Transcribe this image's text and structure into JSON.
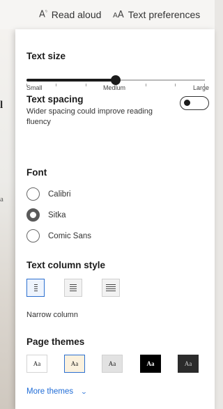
{
  "toolbar": {
    "read_aloud": {
      "label": "Read aloud",
      "icon": "read-aloud-icon"
    },
    "text_preferences": {
      "label": "Text preferences",
      "icon": "text-preferences-icon"
    }
  },
  "background": {
    "glyph1": "l",
    "glyph2": "a"
  },
  "panel": {
    "text_size": {
      "title": "Text size",
      "level": 0.5,
      "labels": {
        "small": "Small",
        "medium": "Medium",
        "large": "Large"
      },
      "selected": "Medium"
    },
    "text_spacing": {
      "title": "Text spacing",
      "description": "Wider spacing could improve reading fluency",
      "enabled": false
    },
    "font": {
      "title": "Font",
      "options": [
        {
          "label": "Calibri",
          "checked": false
        },
        {
          "label": "Sitka",
          "checked": true
        },
        {
          "label": "Comic Sans",
          "checked": false
        }
      ]
    },
    "column_style": {
      "title": "Text column style",
      "options": [
        "narrow",
        "medium",
        "wide"
      ],
      "selected": "narrow",
      "caption": "Narrow column"
    },
    "page_themes": {
      "title": "Page themes",
      "sample": "Aa",
      "themes": [
        {
          "name": "light",
          "bg": "#ffffff",
          "fg": "#1b1b1b",
          "border": "#d4d4d4"
        },
        {
          "name": "sepia",
          "bg": "#fbf1de",
          "fg": "#1b1b1b",
          "border": "#2b6fd0",
          "selected": true
        },
        {
          "name": "gray",
          "bg": "#e2e2e2",
          "fg": "#1b1b1b",
          "border": "#d0d0d0"
        },
        {
          "name": "black",
          "bg": "#000000",
          "fg": "#ffffff",
          "border": "#000000"
        },
        {
          "name": "dark",
          "bg": "#2b2b2b",
          "fg": "#c8c8c8",
          "border": "#2b2b2b"
        }
      ],
      "more_label": "More themes"
    }
  }
}
